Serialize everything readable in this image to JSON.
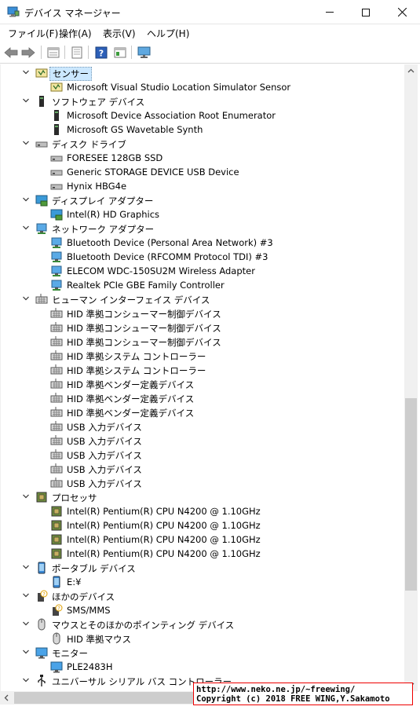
{
  "window": {
    "title": "デバイス マネージャー"
  },
  "menu": {
    "file": "ファイル(F)",
    "action": "操作(A)",
    "view": "表示(V)",
    "help": "ヘルプ(H)"
  },
  "toolbar": {
    "buttons": [
      "back-icon",
      "forward-icon",
      "properties-icon",
      "refresh-icon",
      "help-icon",
      "view-icon",
      "monitor-icon"
    ]
  },
  "tree": {
    "sensors": {
      "label": "センサー",
      "items": [
        "Microsoft Visual Studio Location Simulator Sensor"
      ]
    },
    "software": {
      "label": "ソフトウェア デバイス",
      "items": [
        "Microsoft Device Association Root Enumerator",
        "Microsoft GS Wavetable Synth"
      ]
    },
    "disk": {
      "label": "ディスク ドライブ",
      "items": [
        "FORESEE 128GB SSD",
        "Generic STORAGE DEVICE USB Device",
        "Hynix HBG4e"
      ]
    },
    "display": {
      "label": "ディスプレイ アダプター",
      "items": [
        "Intel(R) HD Graphics"
      ]
    },
    "network": {
      "label": "ネットワーク アダプター",
      "items": [
        "Bluetooth Device (Personal Area Network) #3",
        "Bluetooth Device (RFCOMM Protocol TDI) #3",
        "ELECOM WDC-150SU2M Wireless Adapter",
        "Realtek PCIe GBE Family Controller"
      ]
    },
    "hid": {
      "label": "ヒューマン インターフェイス デバイス",
      "items": [
        "HID 準拠コンシューマー制御デバイス",
        "HID 準拠コンシューマー制御デバイス",
        "HID 準拠コンシューマー制御デバイス",
        "HID 準拠システム コントローラー",
        "HID 準拠システム コントローラー",
        "HID 準拠ベンダー定義デバイス",
        "HID 準拠ベンダー定義デバイス",
        "HID 準拠ベンダー定義デバイス",
        "USB 入力デバイス",
        "USB 入力デバイス",
        "USB 入力デバイス",
        "USB 入力デバイス",
        "USB 入力デバイス"
      ]
    },
    "processor": {
      "label": "プロセッサ",
      "items": [
        "Intel(R) Pentium(R) CPU N4200 @ 1.10GHz",
        "Intel(R) Pentium(R) CPU N4200 @ 1.10GHz",
        "Intel(R) Pentium(R) CPU N4200 @ 1.10GHz",
        "Intel(R) Pentium(R) CPU N4200 @ 1.10GHz"
      ]
    },
    "portable": {
      "label": "ポータブル デバイス",
      "items": [
        "E:¥"
      ]
    },
    "other": {
      "label": "ほかのデバイス",
      "items": [
        "SMS/MMS"
      ]
    },
    "mouse": {
      "label": "マウスとそのほかのポインティング デバイス",
      "items": [
        "HID 準拠マウス"
      ]
    },
    "monitor": {
      "label": "モニター",
      "items": [
        "PLE2483H"
      ]
    },
    "usb": {
      "label": "ユニバーサル シリアル バス コントローラー",
      "items": []
    }
  },
  "stamp": {
    "line1": "http://www.neko.ne.jp/~freewing/",
    "line2": "Copyright (c) 2018 FREE WING,Y.Sakamoto"
  },
  "colors": {
    "selection": "#cce8ff",
    "stamp_border": "#e00000"
  }
}
